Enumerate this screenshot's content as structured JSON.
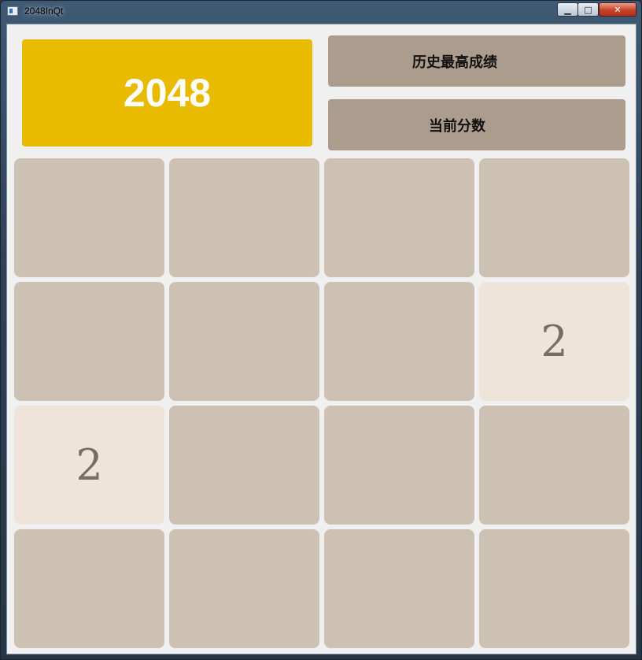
{
  "window": {
    "title": "2048InQt"
  },
  "titlebar": {
    "minimize_glyph": "▁",
    "maximize_glyph": "□",
    "close_glyph": "✕"
  },
  "header": {
    "logo": "2048",
    "best_score_label": "历史最高成绩",
    "current_score_label": "当前分数"
  },
  "colors": {
    "logo_bg": "#e8ba00",
    "score_box_bg": "#ac9c8e",
    "empty_tile": "#cdc1b4",
    "tile_2": "#eee4da",
    "tile_text": "#776e65",
    "background": "#f1f0f0"
  },
  "board": {
    "rows": [
      [
        "",
        "",
        "",
        ""
      ],
      [
        "",
        "",
        "",
        "2"
      ],
      [
        "2",
        "",
        "",
        ""
      ],
      [
        "",
        "",
        "",
        ""
      ]
    ]
  }
}
